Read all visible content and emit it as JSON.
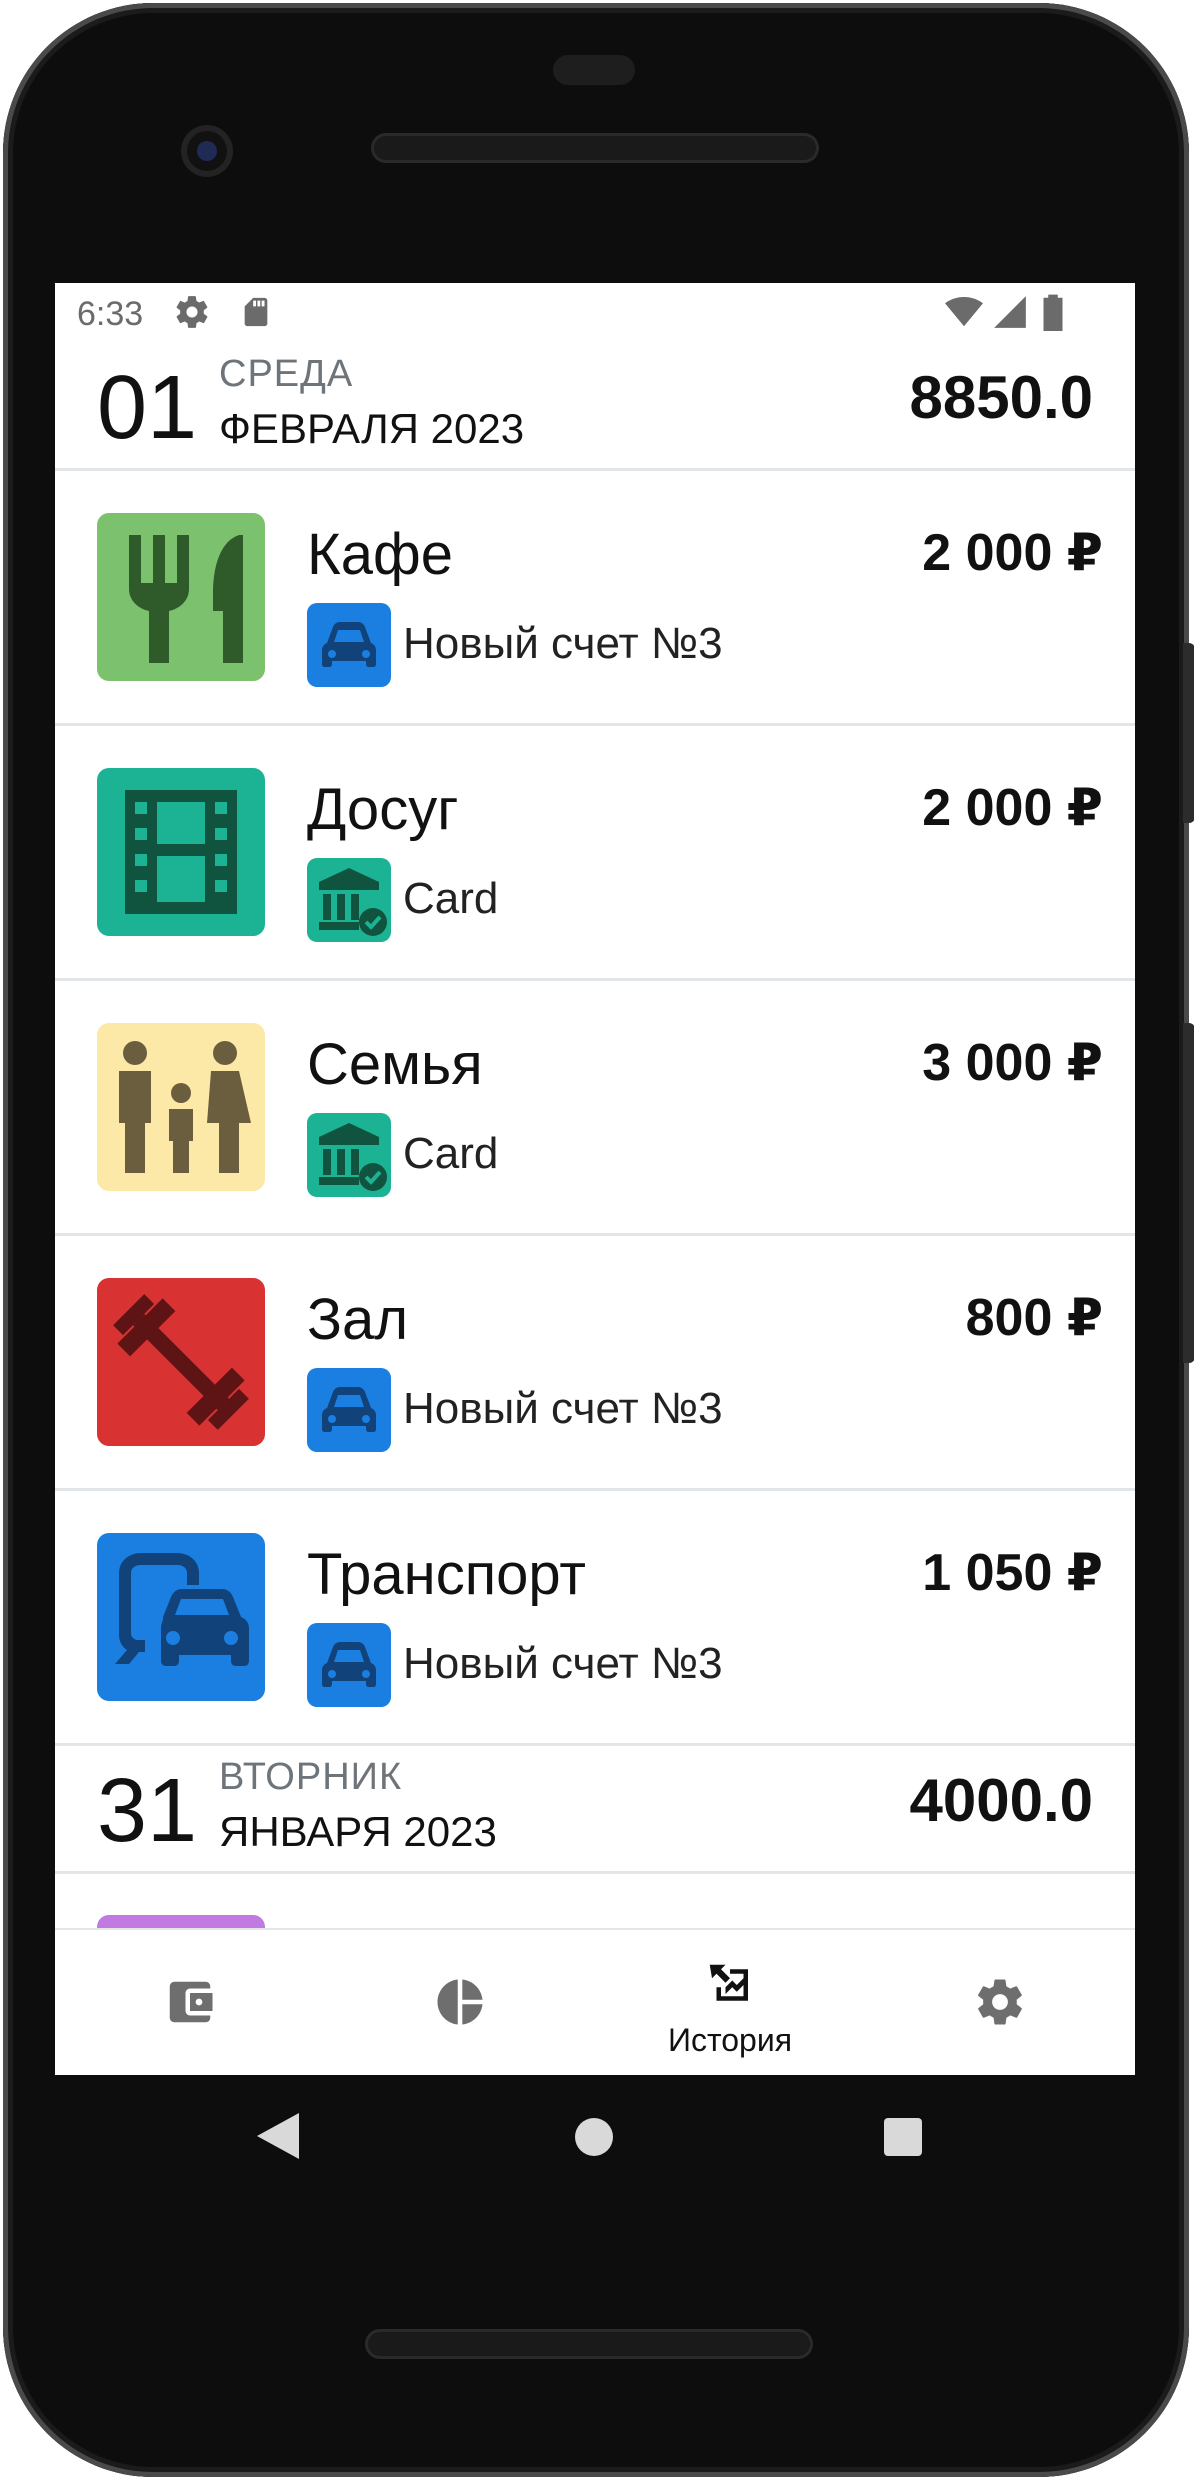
{
  "status_bar": {
    "time": "6:33",
    "left_icons": [
      "gear-icon",
      "sd-card-icon"
    ],
    "right_icons": [
      "wifi-icon",
      "signal-icon",
      "battery-icon"
    ]
  },
  "groups": [
    {
      "day": "01",
      "weekday": "СРЕДА",
      "month_year": "ФЕВРАЛЯ 2023",
      "total": "8850.0",
      "transactions": [
        {
          "category": "Кафе",
          "category_icon": "fork-knife-icon",
          "category_color": "#7cc16e",
          "account": "Новый счет №3",
          "account_icon": "car-icon",
          "account_color": "#1a7fe0",
          "amount": "2 000 ₽"
        },
        {
          "category": "Досуг",
          "category_icon": "film-icon",
          "category_color": "#1bb394",
          "account": "Card",
          "account_icon": "bank-icon",
          "account_color": "#1bb394",
          "amount": "2 000 ₽"
        },
        {
          "category": "Семья",
          "category_icon": "family-icon",
          "category_color": "#fde9a7",
          "account": "Card",
          "account_icon": "bank-icon",
          "account_color": "#1bb394",
          "amount": "3 000 ₽"
        },
        {
          "category": "Зал",
          "category_icon": "dumbbell-icon",
          "category_color": "#d83232",
          "account": "Новый счет №3",
          "account_icon": "car-icon",
          "account_color": "#1a7fe0",
          "amount": "800 ₽"
        },
        {
          "category": "Транспорт",
          "category_icon": "transport-icon",
          "category_color": "#1a7fe0",
          "account": "Новый счет №3",
          "account_icon": "car-icon",
          "account_color": "#1a7fe0",
          "amount": "1 050 ₽"
        }
      ]
    },
    {
      "day": "31",
      "weekday": "ВТОРНИК",
      "month_year": "ЯНВАРЯ 2023",
      "total": "4000.0",
      "transactions": []
    }
  ],
  "bottom_nav": [
    {
      "icon": "wallet-icon",
      "label": "",
      "active": false
    },
    {
      "icon": "pie-chart-icon",
      "label": "",
      "active": false
    },
    {
      "icon": "history-icon",
      "label": "История",
      "active": true
    },
    {
      "icon": "gear-icon",
      "label": "",
      "active": false
    }
  ],
  "system_nav": [
    "back-icon",
    "home-icon",
    "recents-icon"
  ]
}
